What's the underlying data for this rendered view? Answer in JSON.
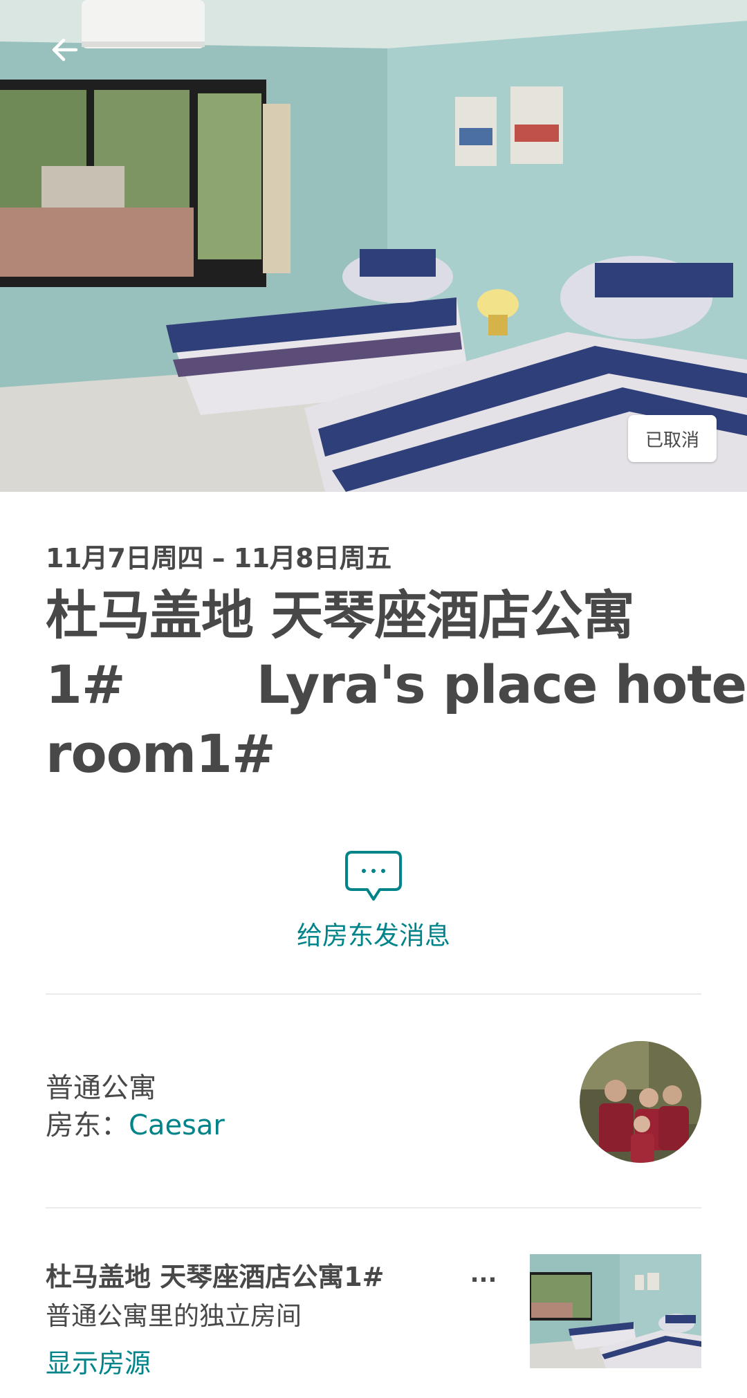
{
  "hero": {
    "status_badge": "已取消",
    "back_icon": "arrow-left-icon",
    "colors": {
      "wall": "#9fc4c2",
      "badge_bg": "#ffffff"
    }
  },
  "reservation": {
    "dates": "11月7日周四 – 11月8日周五",
    "title_lines": [
      "杜马盖地 天琴座酒店公寓",
      "1#",
      "Lyra's place hotel",
      "room1#"
    ]
  },
  "message_host": {
    "icon": "chat-bubble-icon",
    "label": "给房东发消息"
  },
  "host": {
    "listing_type": "普通公寓",
    "host_prefix": "房东：",
    "host_name": "Caesar"
  },
  "listing": {
    "name": "杜马盖地 天琴座酒店公寓1#",
    "more_label": "...",
    "subtitle": "普通公寓里的独立房间",
    "show_listing": "显示房源"
  },
  "colors": {
    "text": "#484848",
    "accent": "#008489",
    "divider": "#ebebeb"
  }
}
